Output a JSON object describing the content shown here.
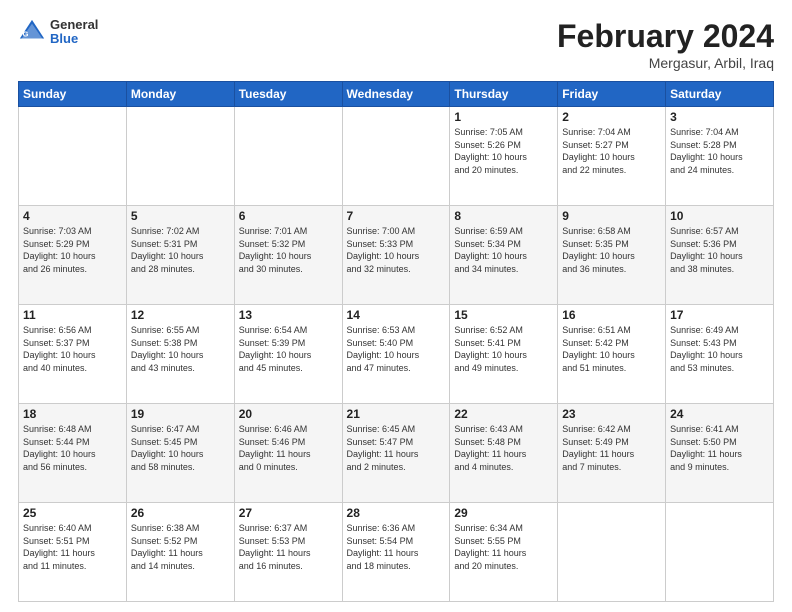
{
  "header": {
    "logo_general": "General",
    "logo_blue": "Blue",
    "month_title": "February 2024",
    "location": "Mergasur, Arbil, Iraq"
  },
  "weekdays": [
    "Sunday",
    "Monday",
    "Tuesday",
    "Wednesday",
    "Thursday",
    "Friday",
    "Saturday"
  ],
  "weeks": [
    [
      {
        "day": "",
        "info": ""
      },
      {
        "day": "",
        "info": ""
      },
      {
        "day": "",
        "info": ""
      },
      {
        "day": "",
        "info": ""
      },
      {
        "day": "1",
        "info": "Sunrise: 7:05 AM\nSunset: 5:26 PM\nDaylight: 10 hours\nand 20 minutes."
      },
      {
        "day": "2",
        "info": "Sunrise: 7:04 AM\nSunset: 5:27 PM\nDaylight: 10 hours\nand 22 minutes."
      },
      {
        "day": "3",
        "info": "Sunrise: 7:04 AM\nSunset: 5:28 PM\nDaylight: 10 hours\nand 24 minutes."
      }
    ],
    [
      {
        "day": "4",
        "info": "Sunrise: 7:03 AM\nSunset: 5:29 PM\nDaylight: 10 hours\nand 26 minutes."
      },
      {
        "day": "5",
        "info": "Sunrise: 7:02 AM\nSunset: 5:31 PM\nDaylight: 10 hours\nand 28 minutes."
      },
      {
        "day": "6",
        "info": "Sunrise: 7:01 AM\nSunset: 5:32 PM\nDaylight: 10 hours\nand 30 minutes."
      },
      {
        "day": "7",
        "info": "Sunrise: 7:00 AM\nSunset: 5:33 PM\nDaylight: 10 hours\nand 32 minutes."
      },
      {
        "day": "8",
        "info": "Sunrise: 6:59 AM\nSunset: 5:34 PM\nDaylight: 10 hours\nand 34 minutes."
      },
      {
        "day": "9",
        "info": "Sunrise: 6:58 AM\nSunset: 5:35 PM\nDaylight: 10 hours\nand 36 minutes."
      },
      {
        "day": "10",
        "info": "Sunrise: 6:57 AM\nSunset: 5:36 PM\nDaylight: 10 hours\nand 38 minutes."
      }
    ],
    [
      {
        "day": "11",
        "info": "Sunrise: 6:56 AM\nSunset: 5:37 PM\nDaylight: 10 hours\nand 40 minutes."
      },
      {
        "day": "12",
        "info": "Sunrise: 6:55 AM\nSunset: 5:38 PM\nDaylight: 10 hours\nand 43 minutes."
      },
      {
        "day": "13",
        "info": "Sunrise: 6:54 AM\nSunset: 5:39 PM\nDaylight: 10 hours\nand 45 minutes."
      },
      {
        "day": "14",
        "info": "Sunrise: 6:53 AM\nSunset: 5:40 PM\nDaylight: 10 hours\nand 47 minutes."
      },
      {
        "day": "15",
        "info": "Sunrise: 6:52 AM\nSunset: 5:41 PM\nDaylight: 10 hours\nand 49 minutes."
      },
      {
        "day": "16",
        "info": "Sunrise: 6:51 AM\nSunset: 5:42 PM\nDaylight: 10 hours\nand 51 minutes."
      },
      {
        "day": "17",
        "info": "Sunrise: 6:49 AM\nSunset: 5:43 PM\nDaylight: 10 hours\nand 53 minutes."
      }
    ],
    [
      {
        "day": "18",
        "info": "Sunrise: 6:48 AM\nSunset: 5:44 PM\nDaylight: 10 hours\nand 56 minutes."
      },
      {
        "day": "19",
        "info": "Sunrise: 6:47 AM\nSunset: 5:45 PM\nDaylight: 10 hours\nand 58 minutes."
      },
      {
        "day": "20",
        "info": "Sunrise: 6:46 AM\nSunset: 5:46 PM\nDaylight: 11 hours\nand 0 minutes."
      },
      {
        "day": "21",
        "info": "Sunrise: 6:45 AM\nSunset: 5:47 PM\nDaylight: 11 hours\nand 2 minutes."
      },
      {
        "day": "22",
        "info": "Sunrise: 6:43 AM\nSunset: 5:48 PM\nDaylight: 11 hours\nand 4 minutes."
      },
      {
        "day": "23",
        "info": "Sunrise: 6:42 AM\nSunset: 5:49 PM\nDaylight: 11 hours\nand 7 minutes."
      },
      {
        "day": "24",
        "info": "Sunrise: 6:41 AM\nSunset: 5:50 PM\nDaylight: 11 hours\nand 9 minutes."
      }
    ],
    [
      {
        "day": "25",
        "info": "Sunrise: 6:40 AM\nSunset: 5:51 PM\nDaylight: 11 hours\nand 11 minutes."
      },
      {
        "day": "26",
        "info": "Sunrise: 6:38 AM\nSunset: 5:52 PM\nDaylight: 11 hours\nand 14 minutes."
      },
      {
        "day": "27",
        "info": "Sunrise: 6:37 AM\nSunset: 5:53 PM\nDaylight: 11 hours\nand 16 minutes."
      },
      {
        "day": "28",
        "info": "Sunrise: 6:36 AM\nSunset: 5:54 PM\nDaylight: 11 hours\nand 18 minutes."
      },
      {
        "day": "29",
        "info": "Sunrise: 6:34 AM\nSunset: 5:55 PM\nDaylight: 11 hours\nand 20 minutes."
      },
      {
        "day": "",
        "info": ""
      },
      {
        "day": "",
        "info": ""
      }
    ]
  ]
}
